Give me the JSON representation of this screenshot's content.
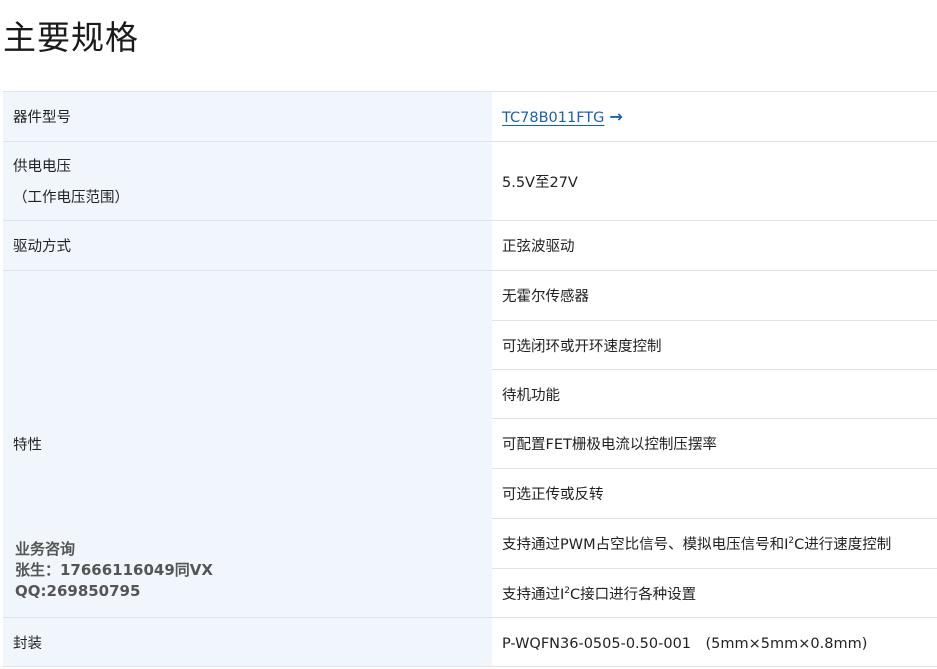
{
  "page": {
    "title": "主要规格"
  },
  "specs": {
    "model": {
      "label": "器件型号",
      "value": "TC78B011FTG",
      "arrow": "→"
    },
    "supply_voltage": {
      "label": "供电电压",
      "label_sub": "（工作电压范围）",
      "value": "5.5V至27V"
    },
    "drive_method": {
      "label": "驱动方式",
      "value": "正弦波驱动"
    },
    "features": {
      "label": "特性",
      "items": [
        "无霍尔传感器",
        "可选闭环或开环速度控制",
        "待机功能",
        "可配置FET栅极电流以控制压摆率",
        "可选正传或反转"
      ],
      "item6": {
        "before": "支持通过PWM占空比信号、模拟电压信号和I",
        "sup": "2",
        "after": "C进行速度控制"
      },
      "item7": {
        "before": "支持通过I",
        "sup": "2",
        "after": "C接口进行各种设置"
      }
    },
    "package": {
      "label": "封装",
      "value": "P-WQFN36-0505-0.50-001　(5mm×5mm×0.8mm)"
    }
  },
  "watermark": {
    "line1": "业务咨询",
    "line2": "张生：17666116049同VX",
    "line3": "QQ:269850795"
  },
  "colors": {
    "label_bg": "#f1f6fc",
    "link": "#1a5fb4",
    "border": "#dde3ea"
  },
  "icons": {
    "link_arrow": "arrow-right-icon"
  }
}
